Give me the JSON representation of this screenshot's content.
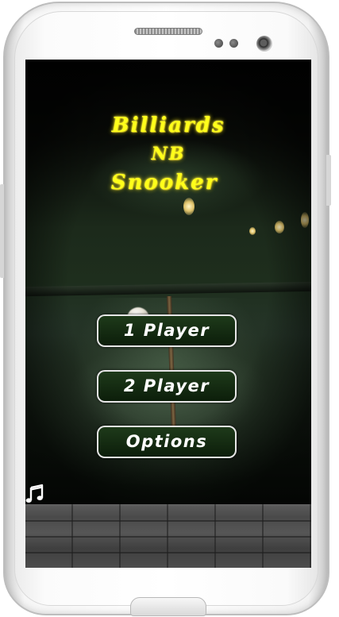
{
  "game": {
    "title_lines": [
      "Billiards",
      "NB",
      "Snooker"
    ]
  },
  "menu": {
    "items": [
      {
        "label": "1 Player"
      },
      {
        "label": "2 Player"
      },
      {
        "label": "Options"
      }
    ]
  },
  "controls": {
    "music_icon": "music-note-icon",
    "music_glyph": "♬"
  },
  "colors": {
    "title": "#ffff1a",
    "button_border": "#e6e6e6",
    "button_fill": "#1e3a1a",
    "button_text": "#ffffff",
    "device_frame": "#f5f5f5"
  }
}
